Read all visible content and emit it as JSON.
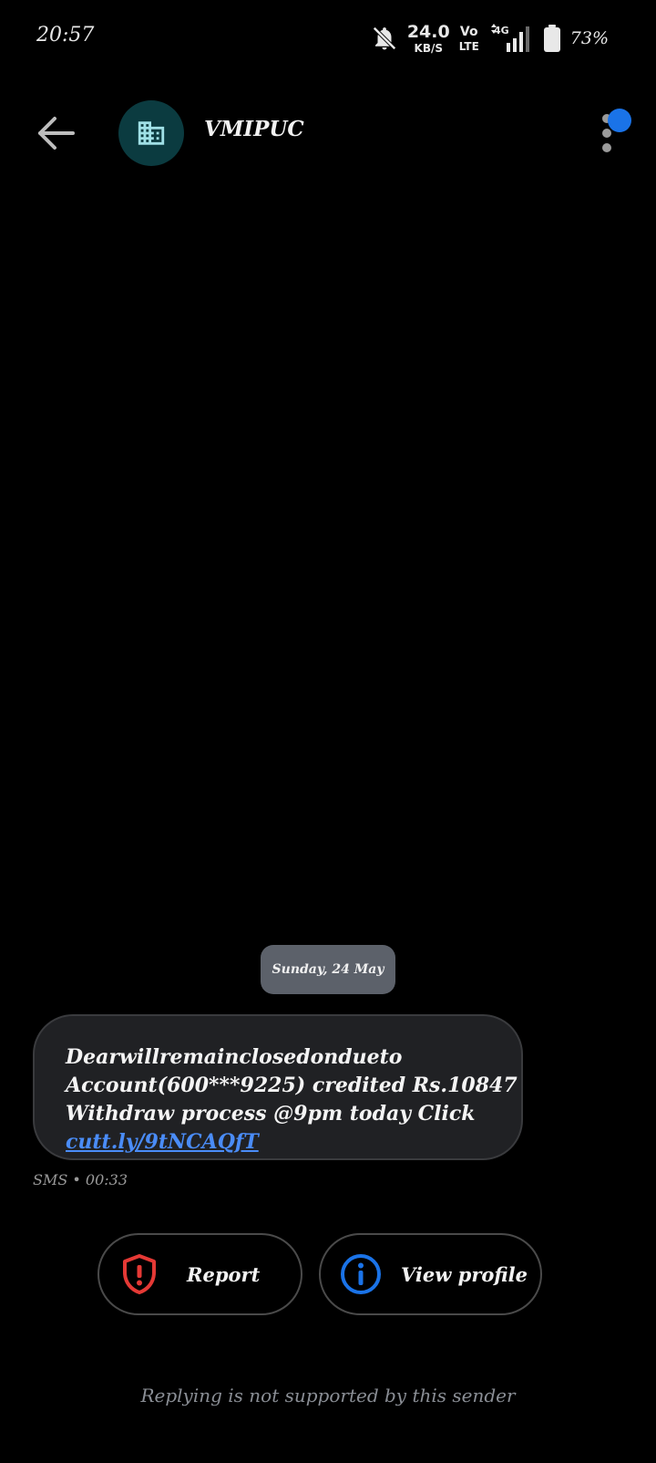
{
  "status_bar": {
    "time": "20:57",
    "net_speed": "24.0",
    "net_speed_unit": "KB/S",
    "volte_top": "Vo",
    "volte_bottom": "LTE",
    "network_type": "4G",
    "battery": "73%"
  },
  "header": {
    "contact_name": "VMIPUC",
    "avatar_icon": "building-icon",
    "menu_badge_color": "#1a73e8"
  },
  "conversation": {
    "date_separator": "Sunday, 24 May",
    "message": {
      "line1": "Dearwillremainclosedondueto",
      "line2": "Account(600***9225) credited Rs.10847",
      "line3": "Withdraw process @9pm today Click",
      "link": "cutt.ly/9tNCAQfT",
      "meta": "SMS • 00:33"
    }
  },
  "actions": {
    "report_label": "Report",
    "view_profile_label": "View profile",
    "report_color": "#e53935",
    "profile_color": "#1a73e8"
  },
  "footer": {
    "note": "Replying is not supported by this sender"
  }
}
